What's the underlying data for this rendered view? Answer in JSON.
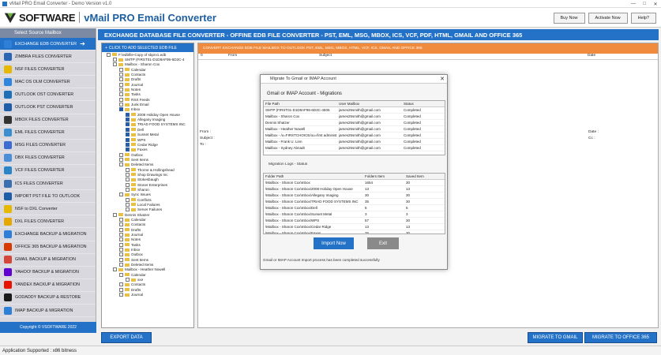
{
  "window": {
    "title": "vMail PRO Email Converter - Demo Version v1.0",
    "controls": [
      "—",
      "□",
      "✕"
    ]
  },
  "header": {
    "brand": "SOFTWARE",
    "product": "vMail PRO Email Converter",
    "buttons": [
      "Buy Now",
      "Activate Now",
      "Help?"
    ]
  },
  "sidebar": {
    "heading": "Select Source Mailbox",
    "items": [
      {
        "label": "EXCHANGE EDB CONVERTER",
        "color": "#2e7fd8",
        "active": true
      },
      {
        "label": "ZIMBRA FILES CONVERTER",
        "color": "#2b63b5"
      },
      {
        "label": "NSF FILES CONVERTER",
        "color": "#e6b800"
      },
      {
        "label": "MAC OS OLM CONVERTER",
        "color": "#2e86de"
      },
      {
        "label": "OUTLOOK OST CONVERTER",
        "color": "#1d6fb8"
      },
      {
        "label": "OUTLOOK PST CONVERTER",
        "color": "#1e5ea8"
      },
      {
        "label": "MBOX FILES CONVERTER",
        "color": "#333333"
      },
      {
        "label": "EML FILES CONVERTER",
        "color": "#3b8ed0"
      },
      {
        "label": "MSG FILES CONVERTER",
        "color": "#3b6ed0"
      },
      {
        "label": "DBX FILES CONVERTER",
        "color": "#4a8fd8"
      },
      {
        "label": "VCF FILES CONVERTER",
        "color": "#2a84c8"
      },
      {
        "label": "ICS FILES CONVERTER",
        "color": "#3a6fb0"
      },
      {
        "label": "IMPORT PST FILE TO OUTLOOK",
        "color": "#1e5ea8"
      },
      {
        "label": "NSF to DXL Converter",
        "color": "#e6b800"
      },
      {
        "label": "DXL FILES CONVERTER",
        "color": "#e6a800"
      },
      {
        "label": "EXCHANGE BACKUP & MIGRATION",
        "color": "#2e7fd8"
      },
      {
        "label": "OFFICE 365 BACKUP & MIGRATION",
        "color": "#d83b01"
      },
      {
        "label": "GMAIL BACKUP & MIGRATION",
        "color": "#d44638"
      },
      {
        "label": "YAHOO! BACKUP & MIGRATION",
        "color": "#5f01d1"
      },
      {
        "label": "YANDEX BACKUP & MIGRATION",
        "color": "#e61400"
      },
      {
        "label": "GODADDY BACKUP & RESTORE",
        "color": "#1a1a1a"
      },
      {
        "label": "IMAP BACKUP & MIGRATION",
        "color": "#2e7fd8"
      }
    ],
    "footer": "Copyright © VSOFTWARE 2022"
  },
  "main_title": "EXCHANGE DATABASE FILE CONVERTER - OFFINE EDB FILE CONVERTER - PST, EML, MSG, MBOX, ICS, VCF, PDF, HTML, GMAIL AND OFFICE 365",
  "tree": {
    "header": "CLICK TO ADD SELECTED EDB FILE",
    "nodes": [
      {
        "label": "F:\\edbfile-Copy of sbprv1.edb",
        "level": 0,
        "checked": false
      },
      {
        "label": "SMTP (FIRST01-D1D8AF95-6D3C-4",
        "level": 1,
        "checked": false
      },
      {
        "label": "Mailbox - Sharon Cox",
        "level": 1,
        "checked": false
      },
      {
        "label": "Calendar",
        "level": 2,
        "checked": false
      },
      {
        "label": "Contacts",
        "level": 2,
        "checked": false
      },
      {
        "label": "Drafts",
        "level": 2,
        "checked": false
      },
      {
        "label": "Journal",
        "level": 2,
        "checked": false
      },
      {
        "label": "Notes",
        "level": 2,
        "checked": false
      },
      {
        "label": "Tasks",
        "level": 2,
        "checked": false
      },
      {
        "label": "RSS Feeds",
        "level": 2,
        "checked": false
      },
      {
        "label": "Junk Email",
        "level": 2,
        "checked": false
      },
      {
        "label": "Inbox",
        "level": 2,
        "checked": true
      },
      {
        "label": "2008 Holiday Open House",
        "level": 3,
        "checked": true
      },
      {
        "label": "Allegany Imaging",
        "level": 3,
        "checked": true
      },
      {
        "label": "TRIAD FOOD SYSTEMS INC",
        "level": 3,
        "checked": true
      },
      {
        "label": "Dell",
        "level": 3,
        "checked": true
      },
      {
        "label": "Sunset Metal",
        "level": 3,
        "checked": true
      },
      {
        "label": "WPS",
        "level": 3,
        "checked": true
      },
      {
        "label": "Cedar Ridge",
        "level": 3,
        "checked": true
      },
      {
        "label": "Faxes",
        "level": 3,
        "checked": true
      },
      {
        "label": "Outbox",
        "level": 2,
        "checked": false
      },
      {
        "label": "Sent Items",
        "level": 2,
        "checked": false
      },
      {
        "label": "Deleted Items",
        "level": 2,
        "checked": false
      },
      {
        "label": "Thorne & Hollingshead",
        "level": 3,
        "checked": false
      },
      {
        "label": "Shop Drawings Inc",
        "level": 3,
        "checked": false
      },
      {
        "label": "Stokesbaugh",
        "level": 3,
        "checked": false
      },
      {
        "label": "Stoner Enterprises",
        "level": 3,
        "checked": false
      },
      {
        "label": "Sharon",
        "level": 3,
        "checked": false
      },
      {
        "label": "Sync Issues",
        "level": 2,
        "checked": false
      },
      {
        "label": "Conflicts",
        "level": 3,
        "checked": false
      },
      {
        "label": "Local Failures",
        "level": 3,
        "checked": false
      },
      {
        "label": "Server Failures",
        "level": 3,
        "checked": false
      },
      {
        "label": "Dennis Shatzer",
        "level": 1,
        "checked": false
      },
      {
        "label": "Calendar",
        "level": 2,
        "checked": false
      },
      {
        "label": "Contacts",
        "level": 2,
        "checked": false
      },
      {
        "label": "Drafts",
        "level": 2,
        "checked": false
      },
      {
        "label": "Journal",
        "level": 2,
        "checked": false
      },
      {
        "label": "Notes",
        "level": 2,
        "checked": false
      },
      {
        "label": "Tasks",
        "level": 2,
        "checked": false
      },
      {
        "label": "Inbox",
        "level": 2,
        "checked": false
      },
      {
        "label": "Outbox",
        "level": 2,
        "checked": false
      },
      {
        "label": "Sent Items",
        "level": 2,
        "checked": false
      },
      {
        "label": "Deleted Items",
        "level": 2,
        "checked": false
      },
      {
        "label": "Mailbox - Heather Nowell",
        "level": 1,
        "checked": false
      },
      {
        "label": "Calendar",
        "level": 2,
        "checked": false
      },
      {
        "label": "xxe",
        "level": 3,
        "checked": false
      },
      {
        "label": "Contacts",
        "level": 2,
        "checked": false
      },
      {
        "label": "Drafts",
        "level": 2,
        "checked": false
      },
      {
        "label": "Journal",
        "level": 2,
        "checked": false
      }
    ]
  },
  "right_panel": {
    "banner": "CONVERT EXCHANGE EDB FILE MAILBOX TO OUTLOOK PST, EML, MSG, MBOX, HTML, VCF, ICS, GMAIL AND OFFICE 365",
    "columns": [
      "0",
      "From",
      "Subject",
      "Date"
    ],
    "from": "From :",
    "subject": "Subject :",
    "to": "To :",
    "date": "Date :",
    "cc": "Cc :"
  },
  "modal": {
    "title": "Migrate To Gmail or IMAP Account",
    "close": "✕",
    "subtitle": "Gmail or IMAP Account - Migrations",
    "grid1_headers": [
      "File Path",
      "User Mailbox",
      "Status"
    ],
    "grid1_rows": [
      [
        "SMTP (FIRST01-D1D8AF95-6D3C-4505",
        "james25smith@gmail.com",
        "Completed"
      ],
      [
        "Mailbox - Sharon Cox",
        "james25smith@gmail.com",
        "Completed"
      ],
      [
        "Dennis Shatzer",
        "james25smith@gmail.com",
        "Completed"
      ],
      [
        "Mailbox - Heather Nowell",
        "james25smith@gmail.com",
        "Completed"
      ],
      [
        "Mailbox - /o=FIRSTCHOICE/ou=first administ",
        "james25smith@gmail.com",
        "Completed"
      ],
      [
        "Mailbox - Frank U. Linn",
        "james25smith@gmail.com",
        "Completed"
      ],
      [
        "Mailbox - Sydney Abnadt",
        "james25smith@gmail.com",
        "Completed"
      ]
    ],
    "logs_label": "Migration Logs - Status",
    "grid2_headers": [
      "Folder Path",
      "Folders Item",
      "Saved Item"
    ],
    "grid2_rows": [
      [
        "\\Mailbox - Sharon Cox\\Inbox",
        "1654",
        "30"
      ],
      [
        "\\Mailbox - Sharon Cox\\Inbox\\2008 Holiday Open House",
        "13",
        "13"
      ],
      [
        "\\Mailbox - Sharon Cox\\Inbox\\Allegany Imaging",
        "30",
        "30"
      ],
      [
        "\\Mailbox - Sharon Cox\\Inbox\\TRIAD FOOD SYSTEMS INC",
        "35",
        "30"
      ],
      [
        "\\Mailbox - Sharon Cox\\Inbox\\Dell",
        "5",
        "5"
      ],
      [
        "\\Mailbox - Sharon Cox\\Inbox\\Sunset Metal",
        "3",
        "3"
      ],
      [
        "\\Mailbox - Sharon Cox\\Inbox\\WPS",
        "57",
        "30"
      ],
      [
        "\\Mailbox - Sharon Cox\\Inbox\\Cedar Ridge",
        "13",
        "13"
      ],
      [
        "\\Mailbox - Sharon Cox\\Inbox\\Faxes",
        "76",
        "30"
      ]
    ],
    "import_label": "Import Now",
    "exit_label": "Exit",
    "message": "Gmail or IMAP Account Import process has been completed successfully"
  },
  "bottom": {
    "export": "EXPORT DATA",
    "gmail": "MIGRATE TO GMAIL",
    "office": "MIGRATE TO OFFICE 365"
  },
  "status": {
    "text": "Application Supported : x86 bitness"
  }
}
